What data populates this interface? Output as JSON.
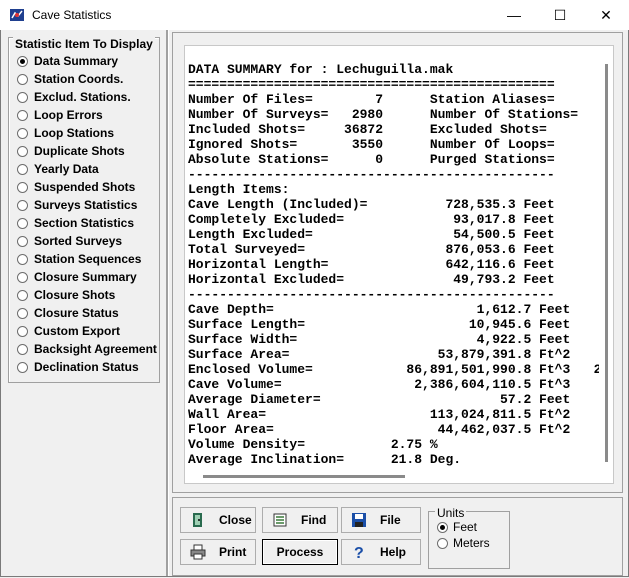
{
  "window": {
    "title": "Cave Statistics",
    "minimize": "—",
    "maximize": "☐",
    "close": "✕"
  },
  "group": {
    "title": "Statistic Item To Display",
    "items": [
      {
        "label": "Data Summary",
        "selected": true
      },
      {
        "label": "Station Coords.",
        "selected": false
      },
      {
        "label": "Exclud. Stations.",
        "selected": false
      },
      {
        "label": "Loop Errors",
        "selected": false
      },
      {
        "label": "Loop Stations",
        "selected": false
      },
      {
        "label": "Duplicate Shots",
        "selected": false
      },
      {
        "label": "Yearly Data",
        "selected": false
      },
      {
        "label": "Suspended Shots",
        "selected": false
      },
      {
        "label": "Surveys Statistics",
        "selected": false
      },
      {
        "label": "Section Statistics",
        "selected": false
      },
      {
        "label": "Sorted Surveys",
        "selected": false
      },
      {
        "label": "Station Sequences",
        "selected": false
      },
      {
        "label": "Closure Summary",
        "selected": false
      },
      {
        "label": "Closure Shots",
        "selected": false
      },
      {
        "label": "Closure Status",
        "selected": false
      },
      {
        "label": "Custom Export",
        "selected": false
      },
      {
        "label": "Backsight Agreement",
        "selected": false
      },
      {
        "label": "Declination Status",
        "selected": false
      }
    ]
  },
  "report": {
    "lines": [
      "DATA SUMMARY for : Lechuguilla.mak",
      "===============================================",
      "Number Of Files=        7      Station Aliases=",
      "Number Of Surveys=   2980      Number Of Stations=",
      "Included Shots=     36872      Excluded Shots=",
      "Ignored Shots=       3550      Number Of Loops=",
      "Absolute Stations=      0      Purged Stations=",
      "-----------------------------------------------",
      "Length Items:",
      "Cave Length (Included)=          728,535.3 Feet",
      "Completely Excluded=              93,017.8 Feet",
      "Length Excluded=                  54,500.5 Feet",
      "Total Surveyed=                  876,053.6 Feet",
      "Horizontal Length=               642,116.6 Feet",
      "Horizontal Excluded=              49,793.2 Feet",
      "-----------------------------------------------",
      "Cave Depth=                          1,612.7 Feet",
      "Surface Length=                     10,945.6 Feet",
      "Surface Width=                       4,922.5 Feet",
      "Surface Area=                   53,879,391.8 Ft^2",
      "Enclosed Volume=            86,891,501,990.8 Ft^3   2",
      "Cave Volume=                 2,386,604,110.5 Ft^3",
      "Average Diameter=                       57.2 Feet",
      "Wall Area=                     113,024,811.5 Ft^2",
      "Floor Area=                     44,462,037.5 Ft^2",
      "Volume Density=           2.75 %",
      "Average Inclination=      21.8 Deg."
    ]
  },
  "buttons": {
    "close": "Close",
    "find": "Find",
    "file": "File",
    "print": "Print",
    "process": "Process",
    "help": "Help"
  },
  "units": {
    "title": "Units",
    "feet": "Feet",
    "meters": "Meters",
    "selected": "Feet"
  }
}
